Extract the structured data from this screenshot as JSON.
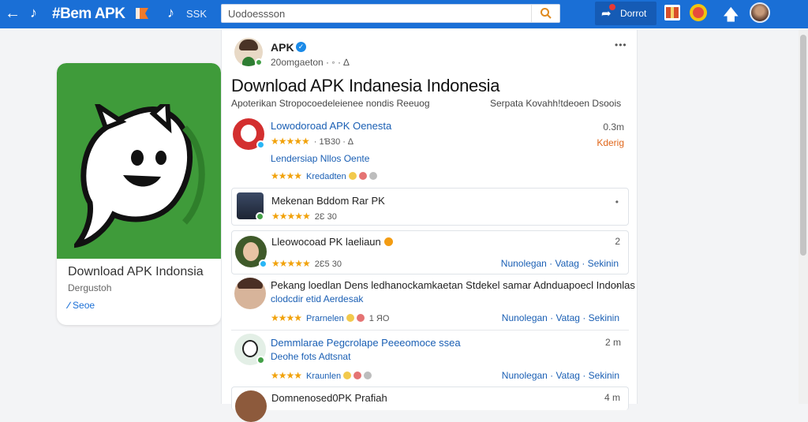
{
  "header": {
    "app_title": "#Bem APK",
    "skk_label": "SSK",
    "search_placeholder": "Uodoessson",
    "download_label": "Dorrot"
  },
  "app_card": {
    "name": "Download APK Indonsia",
    "developer": "Dergustoh",
    "save_label": "Seoe"
  },
  "post": {
    "author": "APK",
    "meta": "20omgaeton · ◦ · ∆",
    "title": "Download APK Indanesia Indonesia",
    "subtitle_left": "Apoterikan Stropocoedeleienee nondis Reeuog",
    "subtitle_right": "Serpata Kovahh!tdeoen Dsoois"
  },
  "items": [
    {
      "title": "Lowodoroad APK Oenesta",
      "rating_text": "· 1Ɓ30 · ∆",
      "time": "0.3m",
      "status": "Kderig",
      "line2": "Lendersiap Nllos Oente",
      "line3": "Kredadten"
    },
    {
      "title": "Mekenan Bddom Rar PK",
      "rating_text": "2Ɛ 30"
    },
    {
      "title": "Lleowocoad PK laeliaun",
      "rating_text": "2Ɛ5 30",
      "time": "2",
      "actions": "Nunolegan · Vatag · Sekinin"
    },
    {
      "title": "Pekang loedlan Dens ledhanockamkaetan Stdekel samar Adnduapoecl Indonlas",
      "line2": "clodcdir etid Aerdesak",
      "line3": "Prarnelen",
      "count": "1 ЯO",
      "actions": "Nunolegan · Vatag · Sekinin"
    },
    {
      "title": "Demmlarae Pegcrolape Peeeomoce ssea",
      "line2": "Deohe fots Adtsnat",
      "line3": "Kraunlen",
      "time": "2 m",
      "actions": "Nunolegan · Vatag · Sekinin"
    },
    {
      "title": "Domnenosed0PK Prafiah",
      "time": "4 m"
    }
  ],
  "colors": {
    "topbar": "#1a6fd6",
    "app_icon_bg": "#3f9b3a",
    "link_blue": "#1a5fb4",
    "star": "#f1a20b",
    "status_orange": "#e0661a"
  }
}
